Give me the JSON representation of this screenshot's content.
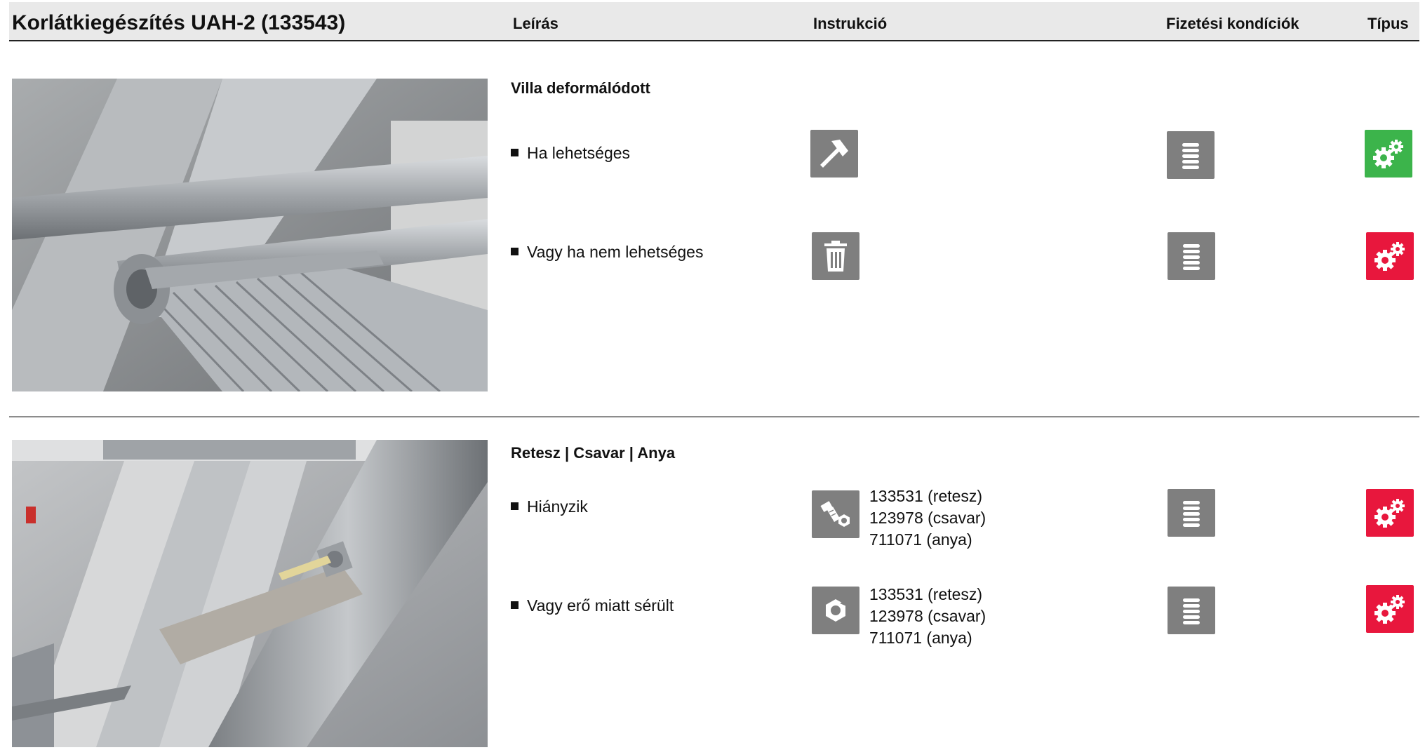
{
  "header": {
    "title": "Korlátkiegészítés UAH-2 (133543)",
    "col_description": "Leírás",
    "col_instruction": "Instrukció",
    "col_payment": "Fizetési kondíciók",
    "col_type": "Típus"
  },
  "sections": [
    {
      "title": "Villa deformálódott",
      "rows": [
        {
          "text": "Ha lehetséges",
          "instruction_icon": "hammer-icon",
          "payment_icon": "coins-icon",
          "type_icon": "gears-icon",
          "type_color": "#3cb44b"
        },
        {
          "text": "Vagy ha nem lehetséges",
          "instruction_icon": "trash-icon",
          "payment_icon": "coins-icon",
          "type_icon": "gears-icon",
          "type_color": "#e8173d"
        }
      ]
    },
    {
      "title": "Retesz | Csavar  | Anya",
      "rows": [
        {
          "text": "Hiányzik",
          "instruction_icon": "bolt-nut-icon",
          "parts": [
            "133531 (retesz)",
            "123978 (csavar)",
            "711071 (anya)"
          ],
          "payment_icon": "coins-icon",
          "type_icon": "gears-icon",
          "type_color": "#e8173d"
        },
        {
          "text": "Vagy erő miatt sérült",
          "instruction_icon": "nut-icon",
          "parts": [
            "133531 (retesz)",
            "123978 (csavar)",
            "711071 (anya)"
          ],
          "payment_icon": "coins-icon",
          "type_icon": "gears-icon",
          "type_color": "#e8173d"
        }
      ]
    }
  ],
  "colors": {
    "icon_gray": "#7f7f7f",
    "type_green": "#3cb44b",
    "type_red": "#e8173d",
    "header_bg": "#e9e9e9"
  }
}
